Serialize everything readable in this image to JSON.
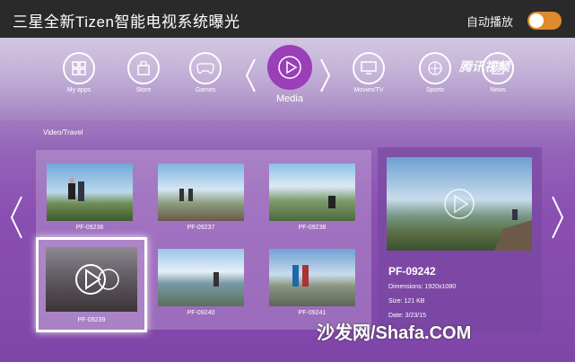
{
  "header": {
    "title": "三星全新Tizen智能电视系统曝光",
    "autoplay_label": "自动播放"
  },
  "nav": {
    "items": [
      {
        "label": "My apps",
        "icon": "grid-icon"
      },
      {
        "label": "Store",
        "icon": "store-icon"
      },
      {
        "label": "Games",
        "icon": "gamepad-icon"
      },
      {
        "label": "Media",
        "icon": "play-icon"
      },
      {
        "label": "Movies/TV",
        "icon": "tv-icon"
      },
      {
        "label": "Sports",
        "icon": "basketball-icon"
      },
      {
        "label": "News",
        "icon": "news-icon"
      }
    ]
  },
  "watermark_top": "腾讯视频",
  "section_label": "Video/Travel",
  "tiles": [
    {
      "label": "PF-09236"
    },
    {
      "label": "PF-09237"
    },
    {
      "label": "PF-09238"
    },
    {
      "label": "PF-09239"
    },
    {
      "label": "PF-09240"
    },
    {
      "label": "PF-09241"
    }
  ],
  "detail": {
    "name": "PF-09242",
    "dimensions": "Dimensions: 1920x1080",
    "size": "Size: 121 KB",
    "date": "Date: 3/23/15"
  },
  "watermark_bottom": "沙发网/Shafa.COM",
  "colors": {
    "toggle_on": "#e08a2e",
    "media_accent": "#9a3fb8"
  }
}
